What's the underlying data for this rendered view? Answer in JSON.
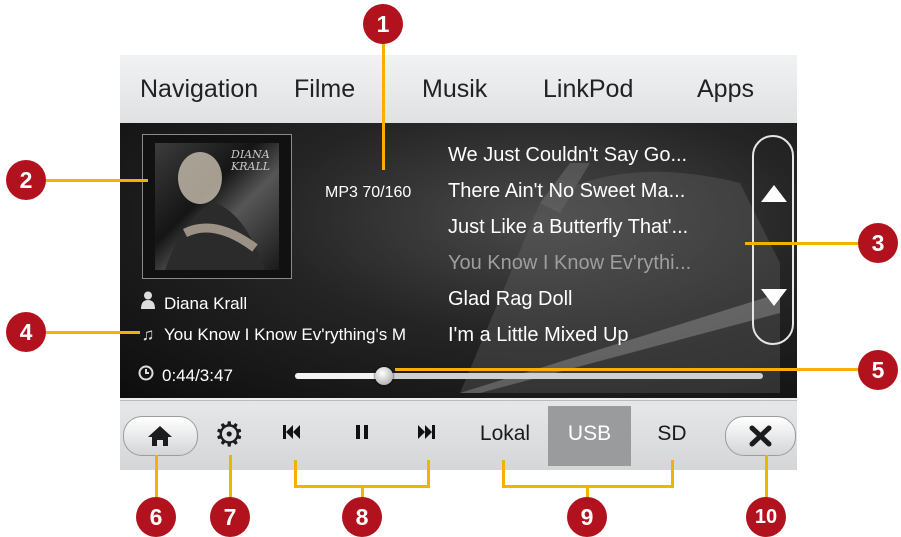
{
  "top_nav": [
    "Navigation",
    "Filme",
    "Musik",
    "LinkPod",
    "Apps"
  ],
  "album_art": {
    "cover_text": "DIANA KRALL"
  },
  "track_counter": "MP3 70/160",
  "artist": {
    "icon": "person-icon",
    "name": "Diana Krall"
  },
  "song": {
    "icon": "music-note-icon",
    "title": "You Know I Know Ev'rything's M"
  },
  "time": "0:44/3:47",
  "progress": {
    "fraction": 0.19
  },
  "playlist": [
    "We Just Couldn't Say Go...",
    "There Ain't No Sweet Ma...",
    "Just Like a Butterfly That'...",
    "You Know I Know Ev'rythi...",
    "Glad Rag Doll",
    "I'm a Little Mixed Up"
  ],
  "playlist_current_index": 3,
  "controls": {
    "home": "home-icon",
    "settings": "gear-icon",
    "previous": "⏮",
    "pause": "⏸",
    "next": "⏭",
    "close": "close-icon"
  },
  "sources": [
    {
      "label": "Lokal",
      "active": false
    },
    {
      "label": "USB",
      "active": true
    },
    {
      "label": "SD",
      "active": false
    }
  ],
  "callouts": [
    "1",
    "2",
    "3",
    "4",
    "5",
    "6",
    "7",
    "8",
    "9",
    "10"
  ],
  "colors": {
    "callout": "#b1121d",
    "leader_line": "#f3b200",
    "active_source": "#9a9b9c"
  }
}
